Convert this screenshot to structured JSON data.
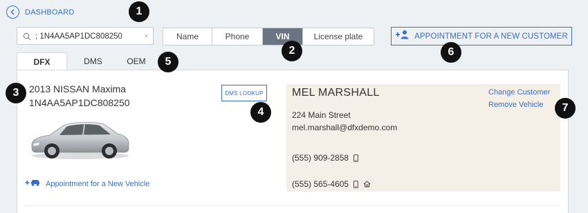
{
  "nav": {
    "back_label": "DASHBOARD"
  },
  "search": {
    "value": "; 1N4AA5AP1DC808250",
    "clear_icon": "×"
  },
  "search_by": {
    "options": [
      "Name",
      "Phone",
      "VIN",
      "License plate"
    ],
    "selected": "VIN"
  },
  "actions": {
    "new_customer_appt": "APPOINTMENT FOR A NEW CUSTOMER"
  },
  "tabs": [
    {
      "label": "DFX",
      "active": true
    },
    {
      "label": "DMS"
    },
    {
      "label": "OEM"
    }
  ],
  "vehicle": {
    "name": "2013 NISSAN Maxima",
    "vin": "1N4AA5AP1DC808250",
    "new_vehicle_appt": "Appointment for a New Vehicle",
    "dms_lookup": "DMS LOOKUP"
  },
  "customer": {
    "name": "MEL MARSHALL",
    "address": "224 Main Street",
    "email": "mel.marshall@dfxdemo.com",
    "phones": [
      "(555) 909-2858",
      "(555) 565-4605"
    ],
    "change_link": "Change Customer",
    "remove_link": "Remove Vehicle"
  },
  "callouts": [
    "1",
    "2",
    "3",
    "4",
    "5",
    "6",
    "7"
  ],
  "colors": {
    "accent": "#3a6fc4",
    "selected_segment": "#6b7480",
    "customer_card": "#f4efe7",
    "badge": "#111111"
  }
}
